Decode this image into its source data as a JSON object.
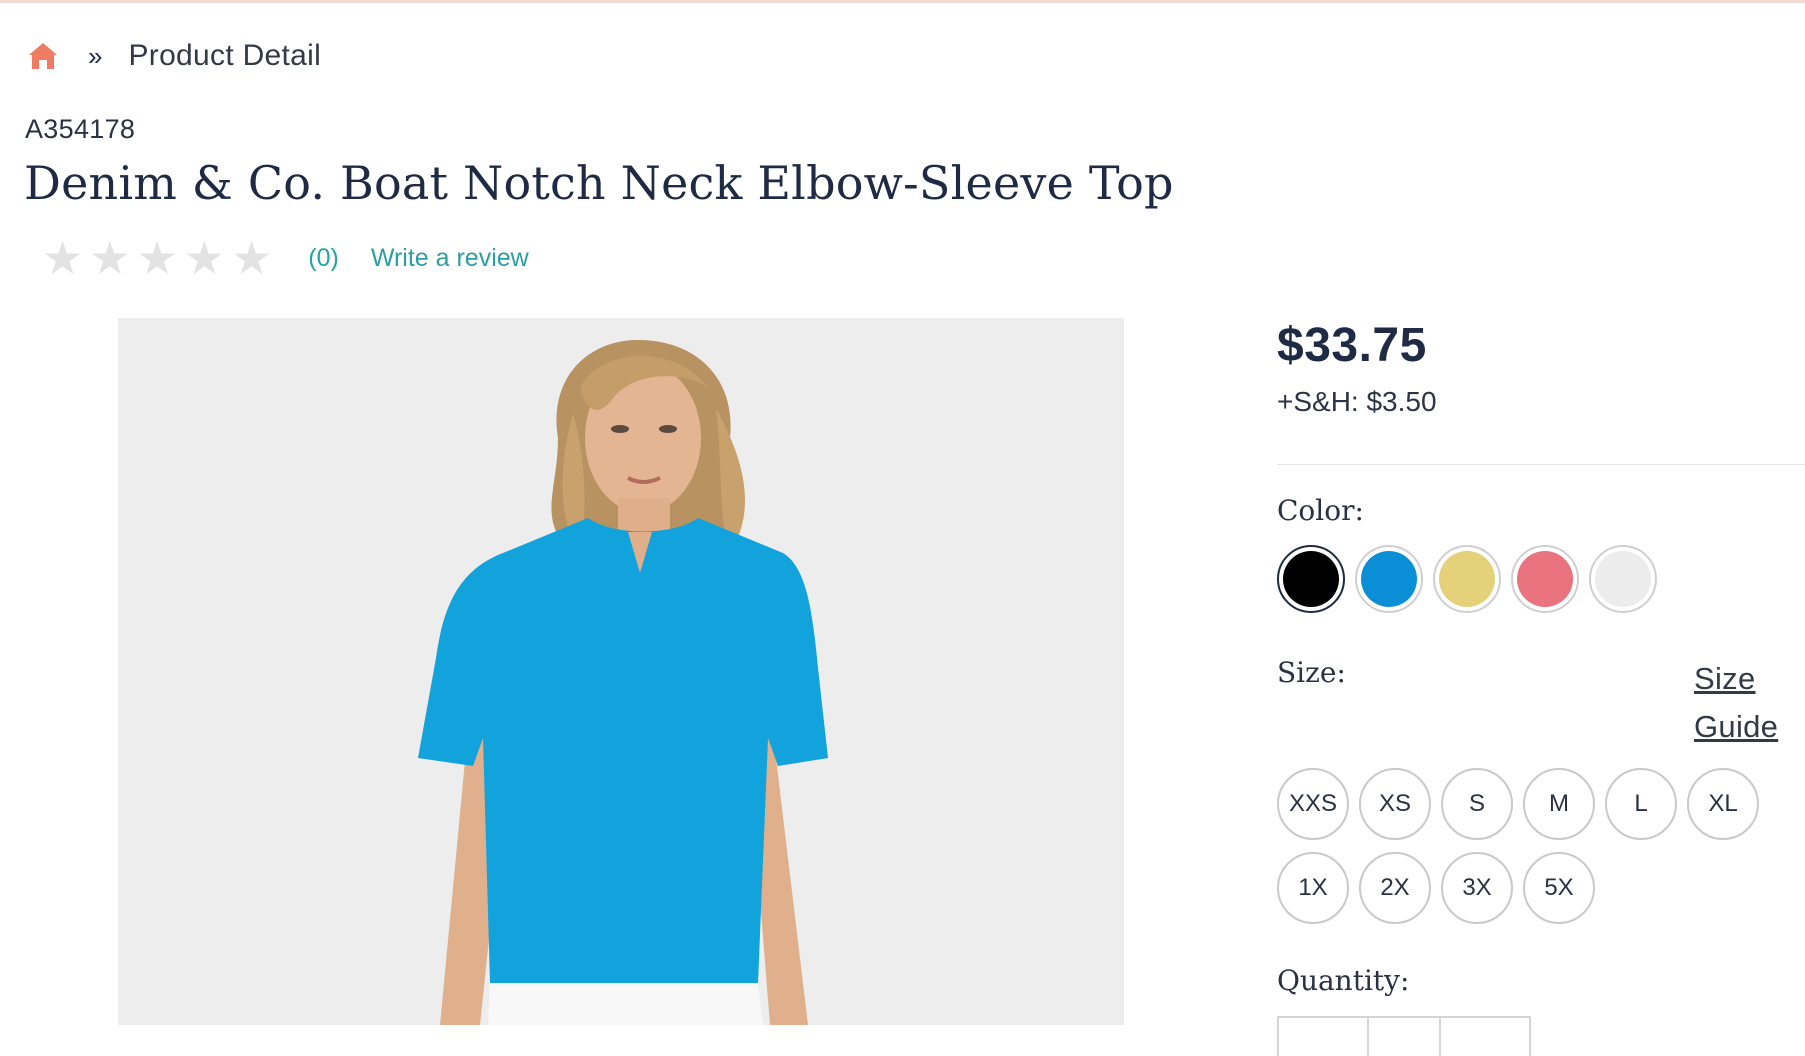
{
  "breadcrumb": {
    "home_icon": "home-icon",
    "separator": "»",
    "current": "Product Detail"
  },
  "product": {
    "sku": "A354178",
    "title": "Denim & Co. Boat Notch Neck Elbow-Sleeve Top",
    "rating": {
      "stars_filled": 0,
      "stars_total": 5,
      "count_label": "(0)",
      "write_review_label": "Write a review"
    },
    "price": "$33.75",
    "shipping": "+S&H: $3.50"
  },
  "colors": {
    "label": "Color:",
    "swatches": [
      {
        "color": "#000000",
        "selected": true
      },
      {
        "color": "#0a8fd6",
        "selected": false
      },
      {
        "color": "#e4d17a",
        "selected": false
      },
      {
        "color": "#e9737e",
        "selected": false
      },
      {
        "color": "#ececec",
        "selected": false
      }
    ]
  },
  "sizes": {
    "label": "Size:",
    "guide_label": "Size Guide",
    "options": [
      "XXS",
      "XS",
      "S",
      "M",
      "L",
      "XL",
      "1X",
      "2X",
      "3X",
      "5X"
    ]
  },
  "quantity": {
    "label": "Quantity:"
  },
  "theme": {
    "accent": "#f07b63",
    "link": "#2e9ea1",
    "text": "#1f2a44",
    "image_bg": "#ececec",
    "top_color": "#12a3dc"
  }
}
